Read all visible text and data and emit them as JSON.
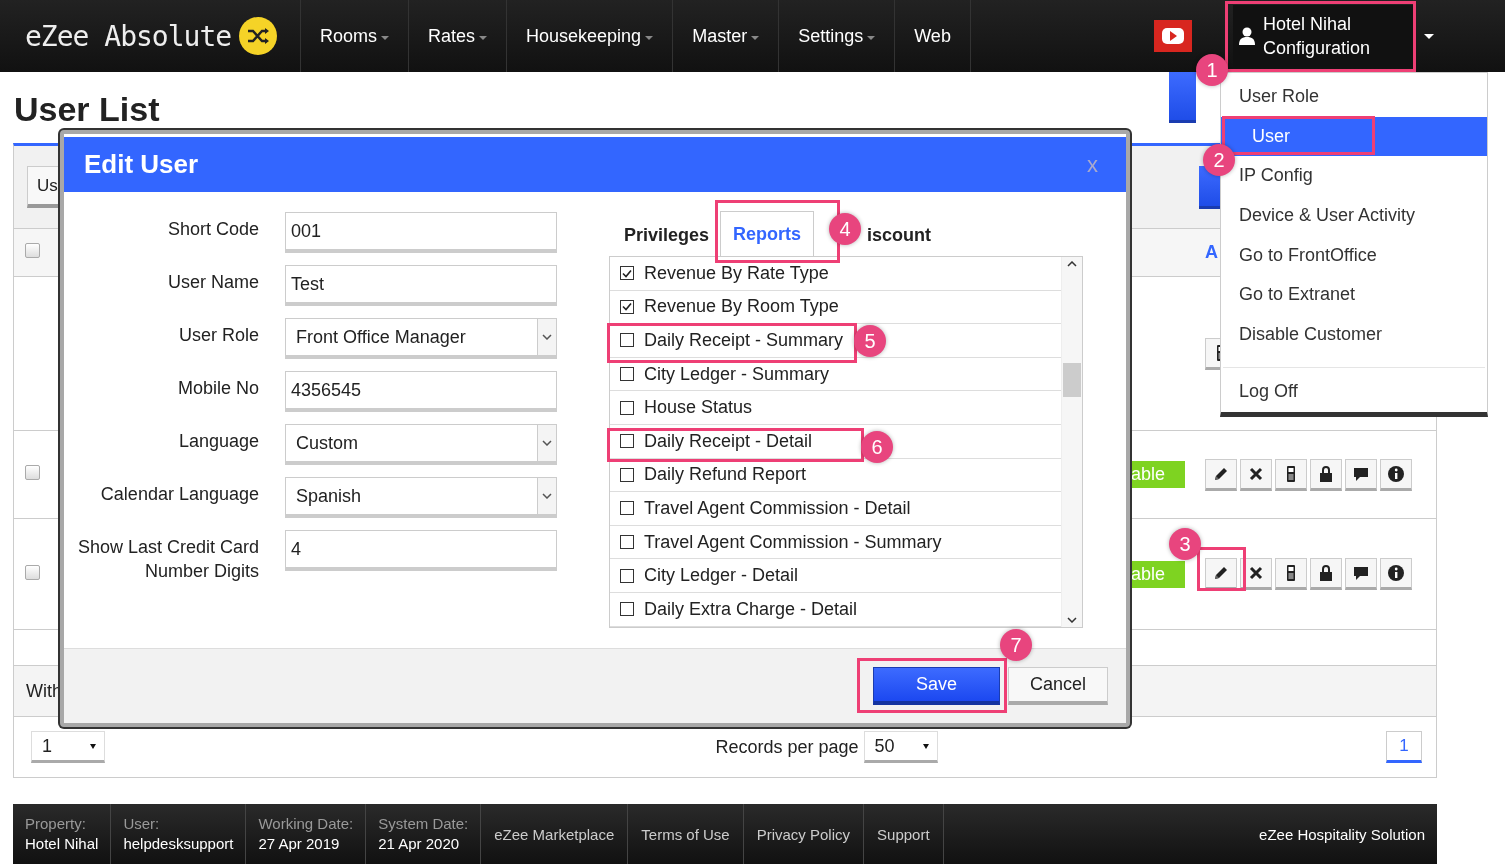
{
  "nav": {
    "logo": "eZee Absolute",
    "items": [
      {
        "label": "Rooms",
        "dropdown": true
      },
      {
        "label": "Rates",
        "dropdown": true
      },
      {
        "label": "Housekeeping",
        "dropdown": true
      },
      {
        "label": "Master",
        "dropdown": true
      },
      {
        "label": "Settings",
        "dropdown": true
      },
      {
        "label": "Web",
        "dropdown": false
      }
    ],
    "user_menu": {
      "name": "Hotel Nihal",
      "subtitle": "Configuration",
      "expanded": true
    }
  },
  "page_title": "User List",
  "user_table": {
    "toolbar_button": "Us",
    "header": {
      "checked": false,
      "label": "A"
    },
    "rows": [
      {
        "kind": "partial"
      },
      {
        "kind": "full",
        "checked": false,
        "status": "able"
      },
      {
        "kind": "full",
        "checked": false,
        "status": "able"
      }
    ],
    "footer_text": "With"
  },
  "pagination": {
    "page_select": "1",
    "records_label": "Records per page",
    "records_select": "50",
    "pages": [
      {
        "label": "1",
        "selected": true
      }
    ]
  },
  "dropdown_menu": {
    "items": [
      {
        "label": "User Role",
        "selected": false
      },
      {
        "label": "User",
        "selected": true
      },
      {
        "label": "IP Config",
        "selected": false
      },
      {
        "label": "Device & User Activity",
        "selected": false
      },
      {
        "label": "Go to FrontOffice",
        "selected": false
      },
      {
        "label": "Go to Extranet",
        "selected": false
      },
      {
        "label": "Disable Customer",
        "selected": false
      }
    ],
    "bottom_item": "Log Off"
  },
  "modal": {
    "title": "Edit User",
    "close": "x",
    "fields": [
      {
        "label": "Short Code",
        "kind": "text",
        "value": "001"
      },
      {
        "label": "User Name",
        "kind": "text",
        "value": "Test"
      },
      {
        "label": "User Role",
        "kind": "select",
        "value": "Front Office Manager"
      },
      {
        "label": "Mobile No",
        "kind": "text",
        "value": "4356545"
      },
      {
        "label": "Language",
        "kind": "select",
        "value": "Custom"
      },
      {
        "label": "Calendar Language",
        "kind": "select",
        "value": "Spanish"
      },
      {
        "label": "Show Last Credit Card Number Digits",
        "kind": "text",
        "value": "4"
      }
    ],
    "tabs": [
      {
        "label": "Privileges",
        "selected": false
      },
      {
        "label": "Reports",
        "selected": true
      },
      {
        "label": "iscount",
        "selected": false
      }
    ],
    "reports": [
      {
        "label": "Revenue By Rate Type",
        "checked": true
      },
      {
        "label": "Revenue By Room Type",
        "checked": true
      },
      {
        "label": "Daily Receipt - Summary",
        "checked": false
      },
      {
        "label": "City Ledger - Summary",
        "checked": false
      },
      {
        "label": "House Status",
        "checked": false
      },
      {
        "label": "Daily Receipt - Detail",
        "checked": false
      },
      {
        "label": "Daily Refund Report",
        "checked": false
      },
      {
        "label": "Travel Agent Commission - Detail",
        "checked": false
      },
      {
        "label": "Travel Agent Commission - Summary",
        "checked": false
      },
      {
        "label": "City Ledger - Detail",
        "checked": false
      },
      {
        "label": "Daily Extra Charge - Detail",
        "checked": false
      }
    ],
    "buttons": [
      {
        "label": "Save",
        "kind": "primary"
      },
      {
        "label": "Cancel",
        "kind": "secondary"
      }
    ]
  },
  "footer": {
    "info": [
      {
        "label": "Property:",
        "value": "Hotel Nihal"
      },
      {
        "label": "User:",
        "value": "helpdesksupport"
      },
      {
        "label": "Working Date:",
        "value": "27 Apr 2019"
      },
      {
        "label": "System Date:",
        "value": "21 Apr 2020"
      }
    ],
    "links": [
      "eZee Marketplace",
      "Terms of Use",
      "Privacy Policy",
      "Support"
    ],
    "brand": "eZee Hospitality Solution"
  },
  "annotations": [
    {
      "label": "1"
    },
    {
      "label": "2"
    },
    {
      "label": "3"
    },
    {
      "label": "4"
    },
    {
      "label": "5"
    },
    {
      "label": "6"
    },
    {
      "label": "7"
    }
  ]
}
